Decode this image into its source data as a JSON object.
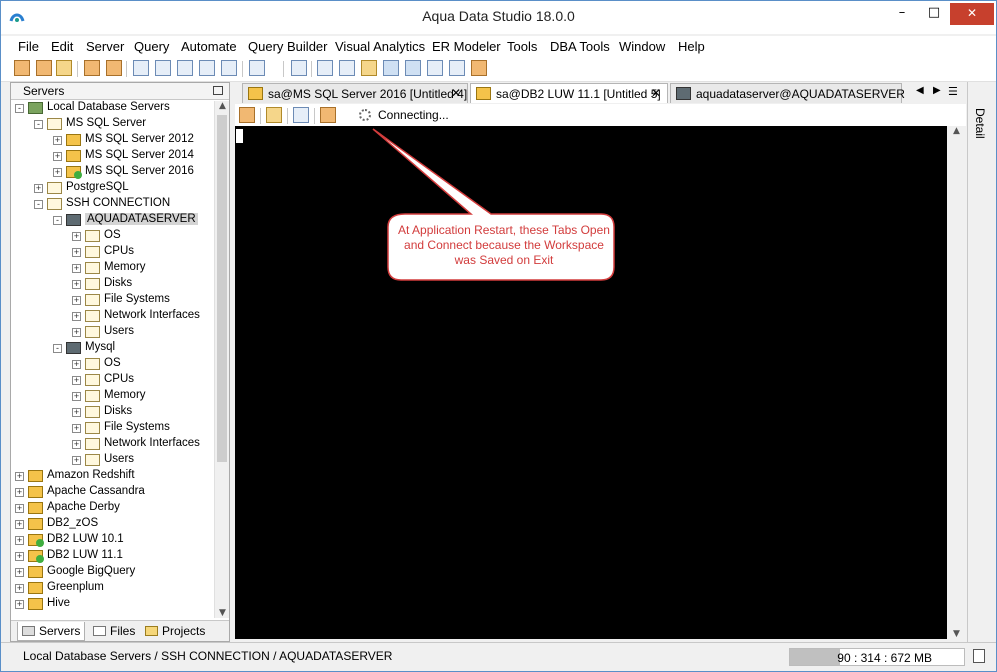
{
  "window": {
    "title": "Aqua Data Studio 18.0.0",
    "min": "–",
    "max": "□",
    "close": "✕"
  },
  "menu": [
    "File",
    "Edit",
    "Server",
    "Query",
    "Automate",
    "Query Builder",
    "Visual Analytics",
    "ER Modeler",
    "Tools",
    "DBA Tools",
    "Window",
    "Help"
  ],
  "left_panel": {
    "title": "Servers",
    "tree": [
      {
        "label": "Local Database Servers",
        "depth": 0,
        "icon": "home-icon",
        "toggle": "-"
      },
      {
        "label": "MS SQL Server",
        "depth": 1,
        "icon": "folder-icon",
        "toggle": "-"
      },
      {
        "label": "MS SQL Server 2012",
        "depth": 2,
        "icon": "database-icon",
        "toggle": "+"
      },
      {
        "label": "MS SQL Server 2014",
        "depth": 2,
        "icon": "database-icon",
        "toggle": "+"
      },
      {
        "label": "MS SQL Server 2016",
        "depth": 2,
        "icon": "database-connected-icon",
        "toggle": "+"
      },
      {
        "label": "PostgreSQL",
        "depth": 1,
        "icon": "folder-icon",
        "toggle": "+"
      },
      {
        "label": "SSH CONNECTION",
        "depth": 1,
        "icon": "folder-icon",
        "toggle": "-"
      },
      {
        "label": "AQUADATASERVER",
        "depth": 2,
        "icon": "server-icon",
        "toggle": "-",
        "selected": true
      },
      {
        "label": "OS",
        "depth": 3,
        "icon": "folder-icon",
        "toggle": "+"
      },
      {
        "label": "CPUs",
        "depth": 3,
        "icon": "folder-icon",
        "toggle": "+"
      },
      {
        "label": "Memory",
        "depth": 3,
        "icon": "folder-icon",
        "toggle": "+"
      },
      {
        "label": "Disks",
        "depth": 3,
        "icon": "folder-icon",
        "toggle": "+"
      },
      {
        "label": "File Systems",
        "depth": 3,
        "icon": "folder-icon",
        "toggle": "+"
      },
      {
        "label": "Network Interfaces",
        "depth": 3,
        "icon": "folder-icon",
        "toggle": "+"
      },
      {
        "label": "Users",
        "depth": 3,
        "icon": "folder-icon",
        "toggle": "+"
      },
      {
        "label": "Mysql",
        "depth": 2,
        "icon": "server-icon",
        "toggle": "-"
      },
      {
        "label": "OS",
        "depth": 3,
        "icon": "folder-icon",
        "toggle": "+"
      },
      {
        "label": "CPUs",
        "depth": 3,
        "icon": "folder-icon",
        "toggle": "+"
      },
      {
        "label": "Memory",
        "depth": 3,
        "icon": "folder-icon",
        "toggle": "+"
      },
      {
        "label": "Disks",
        "depth": 3,
        "icon": "folder-icon",
        "toggle": "+"
      },
      {
        "label": "File Systems",
        "depth": 3,
        "icon": "folder-icon",
        "toggle": "+"
      },
      {
        "label": "Network Interfaces",
        "depth": 3,
        "icon": "folder-icon",
        "toggle": "+"
      },
      {
        "label": "Users",
        "depth": 3,
        "icon": "folder-icon",
        "toggle": "+"
      },
      {
        "label": "Amazon Redshift",
        "depth": 0,
        "icon": "database-icon",
        "toggle": "+"
      },
      {
        "label": "Apache Cassandra",
        "depth": 0,
        "icon": "database-icon",
        "toggle": "+"
      },
      {
        "label": "Apache Derby",
        "depth": 0,
        "icon": "database-icon",
        "toggle": "+"
      },
      {
        "label": "DB2_zOS",
        "depth": 0,
        "icon": "database-icon",
        "toggle": "+"
      },
      {
        "label": "DB2 LUW 10.1",
        "depth": 0,
        "icon": "database-connected-icon",
        "toggle": "+"
      },
      {
        "label": "DB2 LUW 11.1",
        "depth": 0,
        "icon": "database-connected-icon",
        "toggle": "+"
      },
      {
        "label": "Google BigQuery",
        "depth": 0,
        "icon": "database-icon",
        "toggle": "+"
      },
      {
        "label": "Greenplum",
        "depth": 0,
        "icon": "database-icon",
        "toggle": "+"
      },
      {
        "label": "Hive",
        "depth": 0,
        "icon": "database-icon",
        "toggle": "+"
      }
    ],
    "bottom_tabs": [
      "Servers",
      "Files",
      "Projects"
    ]
  },
  "tabs": [
    {
      "label": "sa@MS SQL Server 2016 [Untitled 4]",
      "close": "✕"
    },
    {
      "label": "sa@DB2 LUW 11.1 [Untitled 5]",
      "close": "✕"
    },
    {
      "label": "aquadataserver@AQUADATASERVER",
      "close": ""
    }
  ],
  "editor": {
    "status": "Connecting..."
  },
  "callout": {
    "text": "At Application Restart, these Tabs Open and Connect because the Workspace was Saved on Exit",
    "color": "#d23c3c"
  },
  "detail_label": "Detail",
  "statusbar": {
    "path": "Local Database Servers / SSH CONNECTION / AQUADATASERVER",
    "memory": "90 : 314 : 672 MB",
    "memory_fraction": 0.2865
  }
}
